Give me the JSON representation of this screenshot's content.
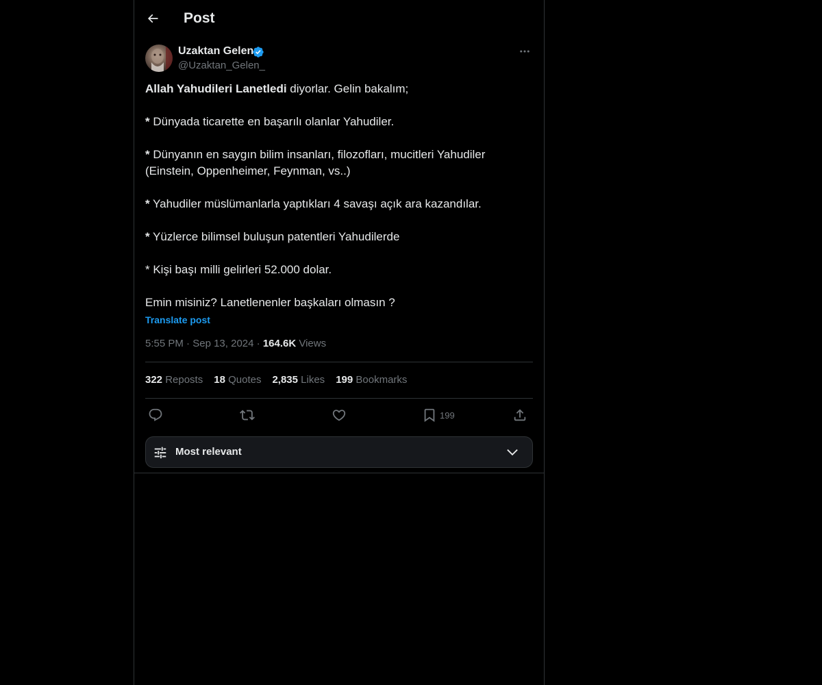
{
  "header": {
    "back_icon": "arrow-left-icon",
    "title": "Post"
  },
  "author": {
    "name": "Uzaktan Gelen",
    "handle": "@Uzaktan_Gelen_",
    "verified_icon": "verified-badge-icon",
    "more_icon": "more-horizontal-icon"
  },
  "post": {
    "line1_bold": "Allah Yahudileri Lanetledi",
    "line1_rest": " diyorlar. Gelin bakalım;",
    "item1_star": "*",
    "item1_text": " Dünyada ticarette en başarılı olanlar Yahudiler.",
    "item2_star": "*",
    "item2_text": " Dünyanın en saygın bilim insanları, filozofları, mucitleri Yahudiler",
    "item2_cont": "(Einstein, Oppenheimer, Feynman, vs..)",
    "item3_star": "*",
    "item3_text": " Yahudiler müslümanlarla yaptıkları 4 savaşı açık ara kazandılar.",
    "item4_star": "*",
    "item4_text": " Yüzlerce bilimsel buluşun patentleri Yahudilerde",
    "item5_text": "* Kişi başı milli gelirleri 52.000 dolar.",
    "closing": "Emin misiniz? Lanetlenenler başkaları olmasın ?",
    "translate": "Translate post"
  },
  "meta": {
    "time": "5:55 PM",
    "sep1": " · ",
    "date": "Sep 13, 2024",
    "sep2": " · ",
    "views_count": "164.6K",
    "views_label": " Views"
  },
  "stats": {
    "reposts_count": "322",
    "reposts_label": " Reposts",
    "quotes_count": "18",
    "quotes_label": " Quotes",
    "likes_count": "2,835",
    "likes_label": " Likes",
    "bookmarks_count": "199",
    "bookmarks_label": " Bookmarks"
  },
  "actions": {
    "reply_icon": "reply-icon",
    "repost_icon": "repost-icon",
    "like_icon": "heart-icon",
    "bookmark_icon": "bookmark-icon",
    "bookmark_count": "199",
    "share_icon": "share-icon"
  },
  "sort": {
    "icon": "sliders-icon",
    "label": "Most relevant",
    "chevron_icon": "chevron-down-icon"
  },
  "colors": {
    "background": "#000000",
    "text": "#e7e9ea",
    "muted": "#71767b",
    "link": "#1d9bf0",
    "border": "#2f3336"
  }
}
